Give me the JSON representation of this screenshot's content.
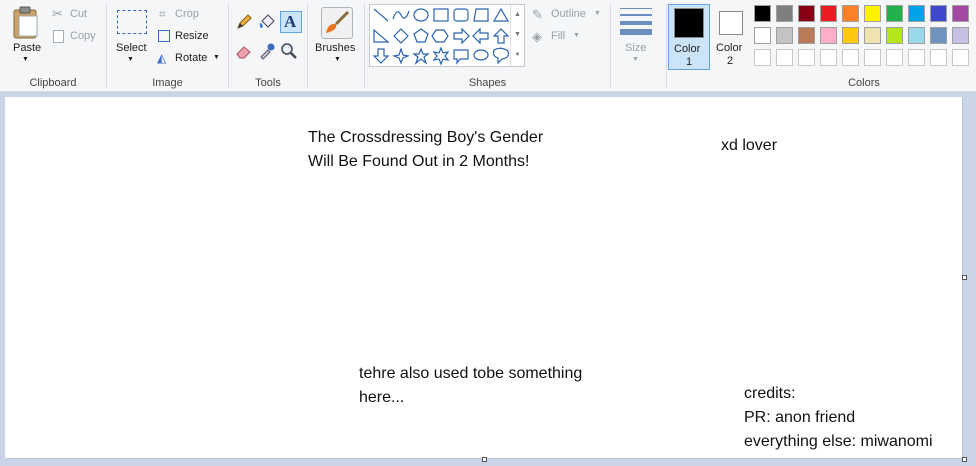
{
  "ribbon": {
    "clipboard": {
      "label": "Clipboard",
      "paste": "Paste",
      "cut": "Cut",
      "copy": "Copy"
    },
    "image": {
      "label": "Image",
      "select": "Select",
      "crop": "Crop",
      "resize": "Resize",
      "rotate": "Rotate"
    },
    "tools": {
      "label": "Tools"
    },
    "brushes": {
      "label": "Brushes"
    },
    "shapes": {
      "label": "Shapes",
      "outline": "Outline",
      "fill": "Fill"
    },
    "size": {
      "label": "Size"
    },
    "color1": {
      "label": "Color",
      "num": "1",
      "value": "#000000"
    },
    "color2": {
      "label": "Color",
      "num": "2",
      "value": "#ffffff"
    },
    "colors": {
      "label": "Colors",
      "row1": [
        "#000000",
        "#7f7f7f",
        "#880015",
        "#ed1c24",
        "#ff7f27",
        "#fff200",
        "#22b14c",
        "#00a2e8",
        "#3f48cc",
        "#a349a4"
      ],
      "row2": [
        "#ffffff",
        "#c3c3c3",
        "#b97a57",
        "#ffaec9",
        "#ffc90e",
        "#efe4b0",
        "#b5e61d",
        "#99d9ea",
        "#7092be",
        "#c8bfe7"
      ],
      "row3": [
        "#ffffff",
        "#ffffff",
        "#ffffff",
        "#ffffff",
        "#ffffff",
        "#ffffff",
        "#ffffff",
        "#ffffff",
        "#ffffff",
        "#ffffff"
      ]
    }
  },
  "canvas": {
    "title_line1": "The Crossdressing Boy's Gender",
    "title_line2": "Will Be Found Out in 2 Months!",
    "tag": "xd lover",
    "note_line1": "tehre also used tobe something",
    "note_line2": "here...",
    "credits_line1": "credits:",
    "credits_line2": "PR: anon friend",
    "credits_line3": "everything else: miwanomi"
  }
}
